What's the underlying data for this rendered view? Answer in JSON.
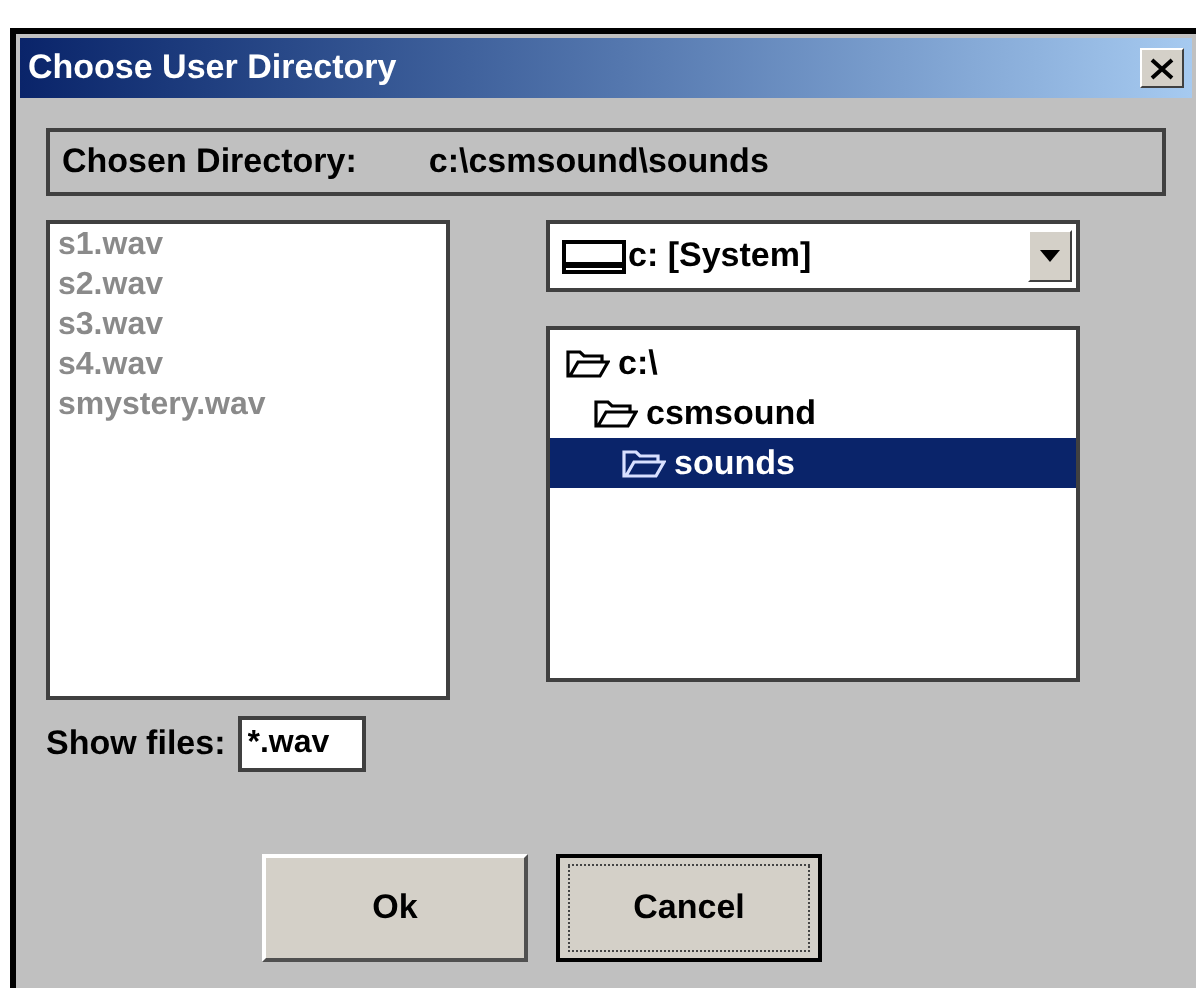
{
  "window": {
    "title": "Choose User Directory"
  },
  "chosen_directory": {
    "label": "Chosen Directory:",
    "value": "c:\\csmsound\\sounds"
  },
  "files": [
    {
      "name": "s1.wav",
      "disabled": true
    },
    {
      "name": "s2.wav",
      "disabled": true
    },
    {
      "name": "s3.wav",
      "disabled": true
    },
    {
      "name": "s4.wav",
      "disabled": true
    },
    {
      "name": "smystery.wav",
      "disabled": true
    }
  ],
  "show_files": {
    "label": "Show files:",
    "value": "*.wav"
  },
  "drive": {
    "value": "c: [System]"
  },
  "folders": [
    {
      "name": "c:\\",
      "selected": false,
      "children": [
        {
          "name": "csmsound",
          "selected": false,
          "children": [
            {
              "name": "sounds",
              "selected": true
            }
          ]
        }
      ]
    }
  ],
  "buttons": [
    {
      "label": "Ok",
      "focused": false
    },
    {
      "label": "Cancel",
      "focused": true
    }
  ]
}
